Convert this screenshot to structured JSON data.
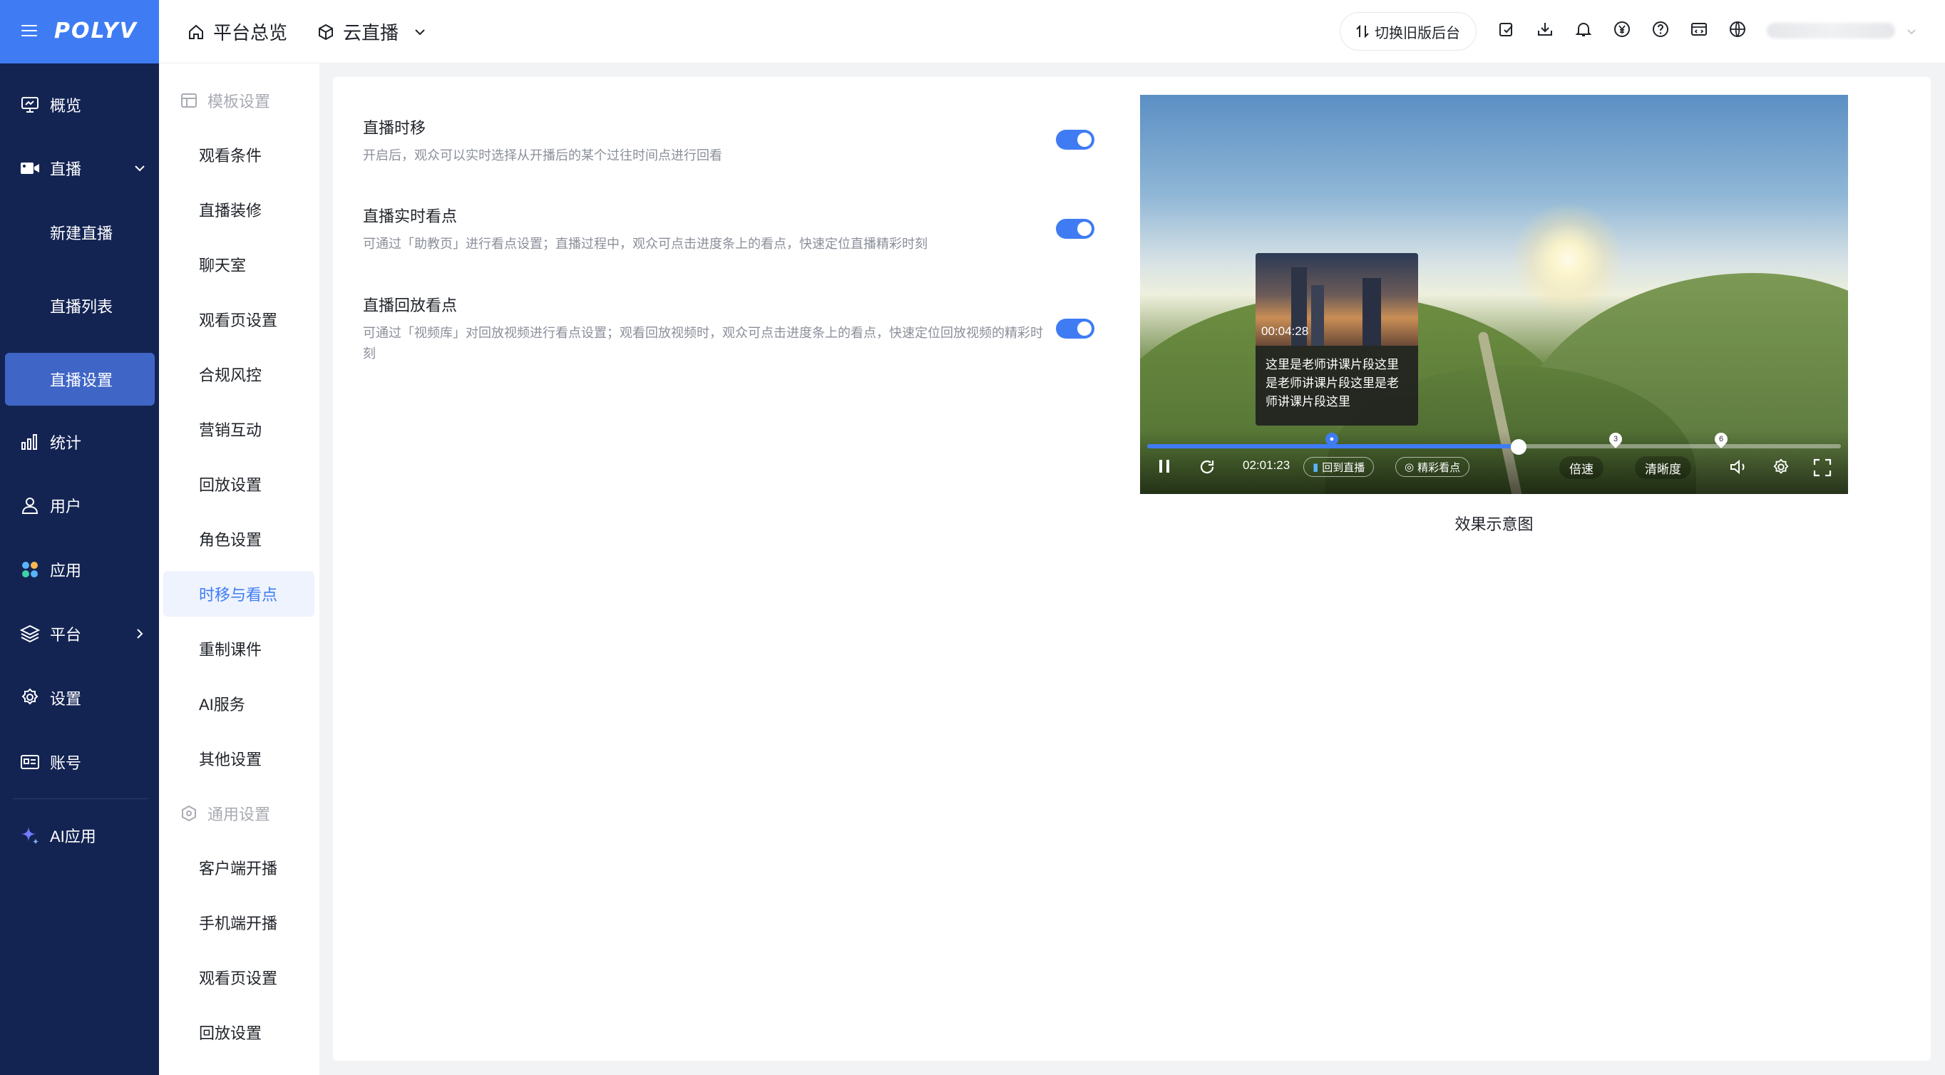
{
  "brand": {
    "logo": "POLYV"
  },
  "nav": {
    "items": [
      {
        "label": "概览",
        "icon": "monitor-icon"
      },
      {
        "label": "直播",
        "icon": "video-icon"
      },
      {
        "label": "统计",
        "icon": "bar-chart-icon"
      },
      {
        "label": "用户",
        "icon": "user-icon"
      },
      {
        "label": "应用",
        "icon": "apps-icon"
      },
      {
        "label": "平台",
        "icon": "layers-icon"
      },
      {
        "label": "设置",
        "icon": "gear-icon"
      },
      {
        "label": "账号",
        "icon": "id-card-icon"
      },
      {
        "label": "AI应用",
        "icon": "sparkle-icon"
      }
    ],
    "live_sub": [
      "新建直播",
      "直播列表",
      "直播设置"
    ]
  },
  "header": {
    "home": "平台总览",
    "product": "云直播",
    "switch_label": "切换旧版后台"
  },
  "subnav": {
    "group1": "模板设置",
    "items1": [
      "观看条件",
      "直播装修",
      "聊天室",
      "观看页设置",
      "合规风控",
      "营销互动",
      "回放设置",
      "角色设置",
      "时移与看点",
      "重制课件",
      "AI服务",
      "其他设置"
    ],
    "group2": "通用设置",
    "items2": [
      "客户端开播",
      "手机端开播",
      "观看页设置",
      "回放设置"
    ]
  },
  "settings": [
    {
      "title": "直播时移",
      "desc": "开启后，观众可以实时选择从开播后的某个过往时间点进行回看",
      "enabled": true
    },
    {
      "title": "直播实时看点",
      "desc": "可通过「助教页」进行看点设置；直播过程中，观众可点击进度条上的看点，快速定位直播精彩时刻",
      "enabled": true
    },
    {
      "title": "直播回放看点",
      "desc": "可通过「视频库」对回放视频进行看点设置；观看回放视频时，观众可点击进度条上的看点，快速定位回放视频的精彩时刻",
      "enabled": true
    }
  ],
  "preview": {
    "tooltip_time": "00:04:28",
    "tooltip_text": "这里是老师讲课片段这里是老师讲课片段这里是老师讲课片段这里",
    "current_time": "02:01:23",
    "back_live": "回到直播",
    "highlights": "精彩看点",
    "speed": "倍速",
    "quality": "清晰度",
    "progress": 0.535,
    "markers": [
      "3",
      "6"
    ],
    "caption": "效果示意图"
  },
  "colors": {
    "nav_bg": "#132453",
    "accent": "#3f7cf4",
    "brand_bar": "#3f7cf4"
  }
}
